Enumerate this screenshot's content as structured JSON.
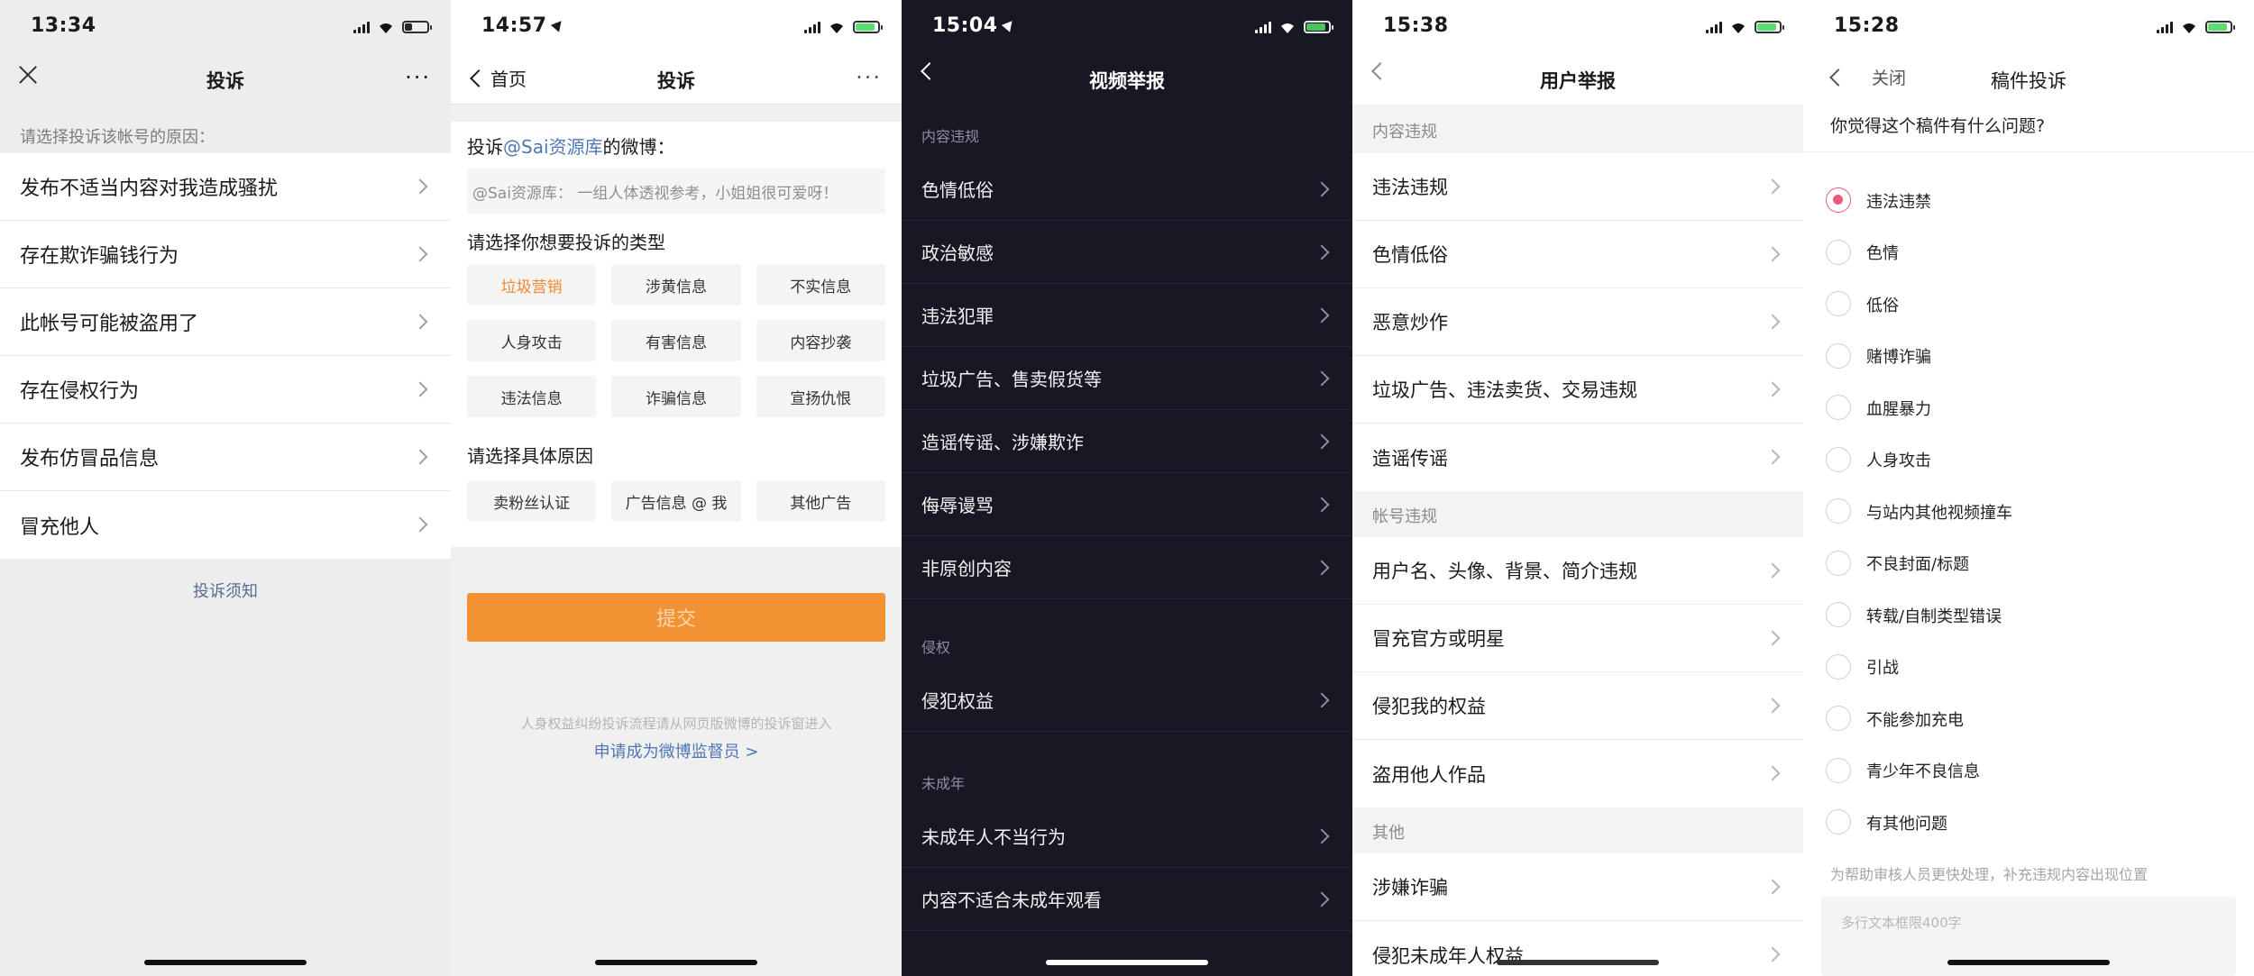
{
  "colors": {
    "weibo_orange": "#f29232",
    "weibo_link": "#4d77b5",
    "wechat_link": "#5b6b93",
    "douyin_bg": "#181824",
    "bili_pink": "#f0577c",
    "battery_green": "#4cd964"
  },
  "screens": [
    {
      "status": {
        "time": "13:34",
        "battery_level": 0.3
      },
      "nav": {
        "title": "投诉",
        "left_icon": "close-icon",
        "right_icon": "more-icon",
        "more": "···"
      },
      "section_label": "请选择投诉该帐号的原因：",
      "items": [
        {
          "label": "发布不适当内容对我造成骚扰"
        },
        {
          "label": "存在欺诈骗钱行为"
        },
        {
          "label": "此帐号可能被盗用了"
        },
        {
          "label": "存在侵权行为"
        },
        {
          "label": "发布仿冒品信息"
        },
        {
          "label": "冒充他人"
        }
      ],
      "notice_link": "投诉须知"
    },
    {
      "status": {
        "time": "14:57",
        "battery_level": 0.8
      },
      "nav": {
        "back_label": "首页",
        "title": "投诉",
        "more": "···"
      },
      "target_prefix": "投诉",
      "target_mention": "@Sai资源库",
      "target_suffix": "的微博：",
      "quote": "@Sai资源库： 一组人体透视参考，小姐姐很可爱呀！",
      "type_heading": "请选择你想要投诉的类型",
      "types": [
        {
          "label": "垃圾营销",
          "selected": true
        },
        {
          "label": "涉黄信息",
          "selected": false
        },
        {
          "label": "不实信息",
          "selected": false
        },
        {
          "label": "人身攻击",
          "selected": false
        },
        {
          "label": "有害信息",
          "selected": false
        },
        {
          "label": "内容抄袭",
          "selected": false
        },
        {
          "label": "违法信息",
          "selected": false
        },
        {
          "label": "诈骗信息",
          "selected": false
        },
        {
          "label": "宣扬仇恨",
          "selected": false
        }
      ],
      "reason_heading": "请选择具体原因",
      "reasons": [
        {
          "label": "卖粉丝认证"
        },
        {
          "label": "广告信息 @ 我"
        },
        {
          "label": "其他广告"
        }
      ],
      "submit_label": "提交",
      "footnote": "人身权益纠纷投诉流程请从网页版微博的投诉窗进入",
      "apply_link": "申请成为微博监督员 >"
    },
    {
      "status": {
        "time": "15:04",
        "battery_level": 0.8
      },
      "nav": {
        "title": "视频举报"
      },
      "groups": [
        {
          "label": "内容违规",
          "items": [
            {
              "label": "色情低俗"
            },
            {
              "label": "政治敏感"
            },
            {
              "label": "违法犯罪"
            },
            {
              "label": "垃圾广告、售卖假货等"
            },
            {
              "label": "造谣传谣、涉嫌欺诈"
            },
            {
              "label": "侮辱谩骂"
            },
            {
              "label": "非原创内容"
            }
          ]
        },
        {
          "label": "侵权",
          "items": [
            {
              "label": "侵犯权益"
            }
          ]
        },
        {
          "label": "未成年",
          "items": [
            {
              "label": "未成年人不当行为"
            },
            {
              "label": "内容不适合未成年观看"
            }
          ]
        }
      ]
    },
    {
      "status": {
        "time": "15:38",
        "battery_level": 0.8
      },
      "nav": {
        "title": "用户举报"
      },
      "groups": [
        {
          "label": "内容违规",
          "items": [
            {
              "label": "违法违规"
            },
            {
              "label": "色情低俗"
            },
            {
              "label": "恶意炒作"
            },
            {
              "label": "垃圾广告、违法卖货、交易违规"
            },
            {
              "label": "造谣传谣"
            }
          ]
        },
        {
          "label": "帐号违规",
          "items": [
            {
              "label": "用户名、头像、背景、简介违规"
            },
            {
              "label": "冒充官方或明星"
            },
            {
              "label": "侵犯我的权益"
            },
            {
              "label": "盗用他人作品"
            }
          ]
        },
        {
          "label": "其他",
          "items": [
            {
              "label": "涉嫌诈骗"
            },
            {
              "label": "侵犯未成年人权益"
            }
          ]
        }
      ]
    },
    {
      "status": {
        "time": "15:28",
        "battery_level": 0.8
      },
      "nav": {
        "close_label": "关闭",
        "title": "稿件投诉"
      },
      "question": "你觉得这个稿件有什么问题?",
      "options": [
        {
          "label": "违法违禁",
          "selected": true
        },
        {
          "label": "色情",
          "selected": false
        },
        {
          "label": "低俗",
          "selected": false
        },
        {
          "label": "赌博诈骗",
          "selected": false
        },
        {
          "label": "血腥暴力",
          "selected": false
        },
        {
          "label": "人身攻击",
          "selected": false
        },
        {
          "label": "与站内其他视频撞车",
          "selected": false
        },
        {
          "label": "不良封面/标题",
          "selected": false
        },
        {
          "label": "转载/自制类型错误",
          "selected": false
        },
        {
          "label": "引战",
          "selected": false
        },
        {
          "label": "不能参加充电",
          "selected": false
        },
        {
          "label": "青少年不良信息",
          "selected": false
        },
        {
          "label": "有其他问题",
          "selected": false
        }
      ],
      "hint": "为帮助审核人员更快处理，补充违规内容出现位置",
      "textarea_placeholder": "多行文本框限400字"
    }
  ]
}
